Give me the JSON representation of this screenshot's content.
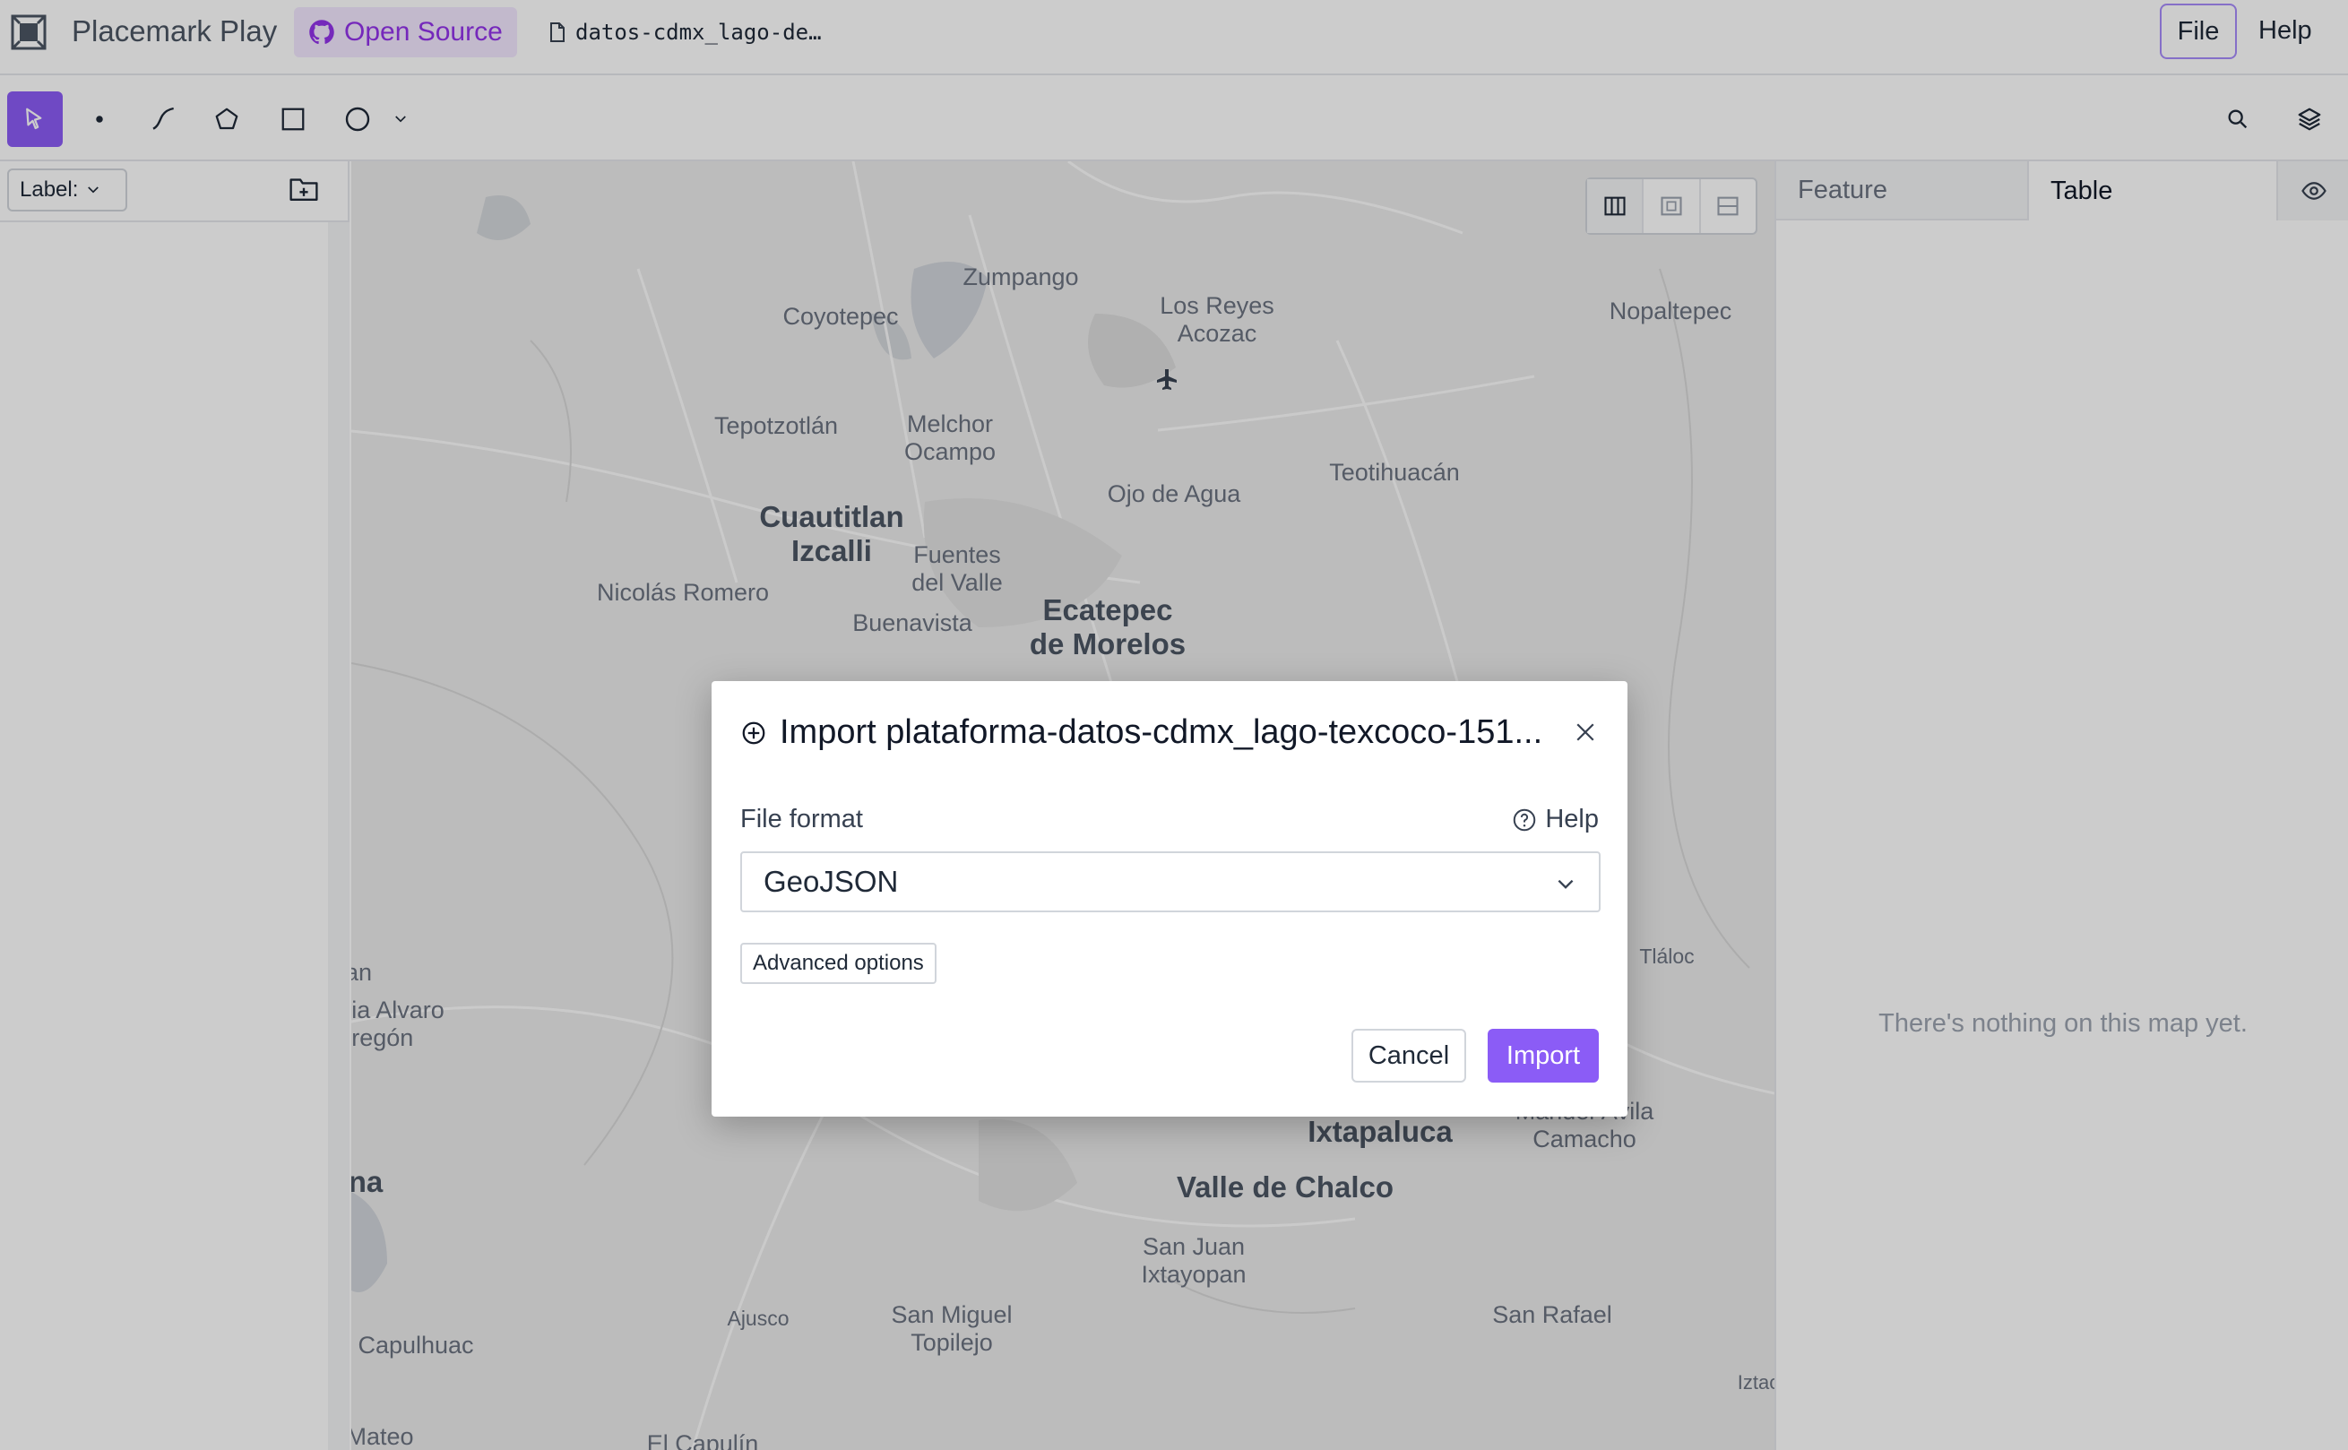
{
  "app": {
    "title": "Placemark Play",
    "open_source_label": "Open Source",
    "filename": "datos-cdmx_lago-de…",
    "menu": {
      "file": "File",
      "help": "Help"
    }
  },
  "toolbar": {
    "tools": [
      "select-icon",
      "point-icon",
      "line-icon",
      "polygon-icon",
      "rectangle-icon",
      "circle-icon",
      "chevron-down-icon"
    ],
    "right": [
      "search-icon",
      "layers-icon"
    ]
  },
  "left_panel": {
    "label_select": "Label:"
  },
  "map": {
    "places": [
      {
        "name": "Zumpango",
        "major": false
      },
      {
        "name": "Coyotepec",
        "major": false
      },
      {
        "name": "Los Reyes\nAcozac",
        "major": false
      },
      {
        "name": "Nopaltepec",
        "major": false
      },
      {
        "name": "Tepotzotlán",
        "major": false
      },
      {
        "name": "Melchor\nOcampo",
        "major": false
      },
      {
        "name": "Teotihuacán",
        "major": false
      },
      {
        "name": "Ojo de Agua",
        "major": false
      },
      {
        "name": "Cuautitlan\nIzcalli",
        "major": true
      },
      {
        "name": "Fuentes\ndel Valle",
        "major": false
      },
      {
        "name": "Nicolás Romero",
        "major": false
      },
      {
        "name": "Buenavista",
        "major": false
      },
      {
        "name": "Ecatepec\nde Morelos",
        "major": true
      },
      {
        "name": "an",
        "major": false
      },
      {
        "name": "ia Alvaro\nregón",
        "major": false
      },
      {
        "name": "Tláloc",
        "major": false
      },
      {
        "name": "eral\nManuel Ávila\nCamacho",
        "major": false
      },
      {
        "name": "Ixtapaluca",
        "major": true
      },
      {
        "name": "na",
        "major": true
      },
      {
        "name": "Valle de Chalco",
        "major": true
      },
      {
        "name": "San Juan\nIxtayopan",
        "major": false
      },
      {
        "name": "Capulhuac",
        "major": false
      },
      {
        "name": "Ajusco",
        "major": false
      },
      {
        "name": "San Miguel\nTopilejo",
        "major": false
      },
      {
        "name": "San Rafael",
        "major": false
      },
      {
        "name": "Iztac",
        "major": false
      },
      {
        "name": "Mateo",
        "major": false
      },
      {
        "name": "El Capulín",
        "major": false
      }
    ]
  },
  "right_panel": {
    "tabs": {
      "feature": "Feature",
      "table": "Table"
    },
    "empty_message": "There's nothing on this map yet."
  },
  "modal": {
    "title": "Import plataforma-datos-cdmx_lago-texcoco-151...",
    "file_format_label": "File format",
    "help_label": "Help",
    "format_value": "GeoJSON",
    "advanced_label": "Advanced options",
    "cancel_label": "Cancel",
    "import_label": "Import"
  },
  "colors": {
    "accent": "#8b5cf6",
    "accent_light": "#f3e8ff"
  }
}
